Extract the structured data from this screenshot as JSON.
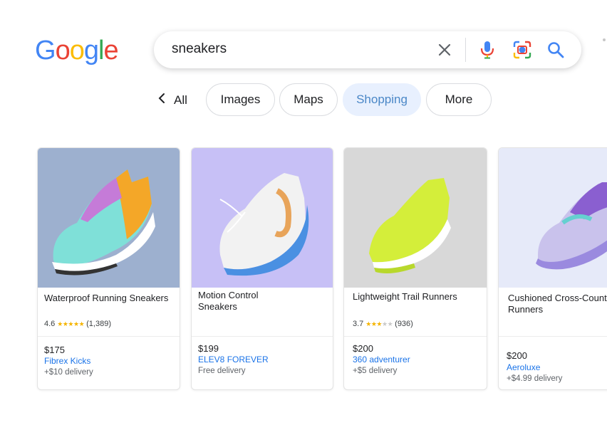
{
  "logo": {
    "letters": [
      {
        "ch": "G",
        "color": "#4285F4"
      },
      {
        "ch": "o",
        "color": "#EA4335"
      },
      {
        "ch": "o",
        "color": "#FBBC05"
      },
      {
        "ch": "g",
        "color": "#4285F4"
      },
      {
        "ch": "l",
        "color": "#34A853"
      },
      {
        "ch": "e",
        "color": "#EA4335"
      }
    ]
  },
  "search": {
    "query": "sneakers"
  },
  "tabs": {
    "all": "All",
    "images": "Images",
    "maps": "Maps",
    "shopping": "Shopping",
    "more": "More"
  },
  "products": [
    {
      "title": "Waterproof Running Sneakers",
      "rating": "4.6",
      "stars": 5,
      "reviews": "(1,389)",
      "price": "$175",
      "seller": "Fibrex Kicks",
      "delivery": "+$10 delivery",
      "bg": "#9db0cf"
    },
    {
      "title": "Motion Control Sneakers",
      "price": "$199",
      "seller": "ELEV8 FOREVER",
      "delivery": "Free delivery",
      "bg": "#c7c0f6"
    },
    {
      "title": "Lightweight Trail Runners",
      "rating": "3.7",
      "stars": 3,
      "reviews": "(936)",
      "price": "$200",
      "seller": "360 adventurer",
      "delivery": "+$5 delivery",
      "bg": "#d8d8d8"
    },
    {
      "title": "Cushioned Cross-Country Runners",
      "price": "$200",
      "seller": "Aeroluxe",
      "delivery": "+$4.99 delivery",
      "bg": "#e6eaf9"
    }
  ]
}
